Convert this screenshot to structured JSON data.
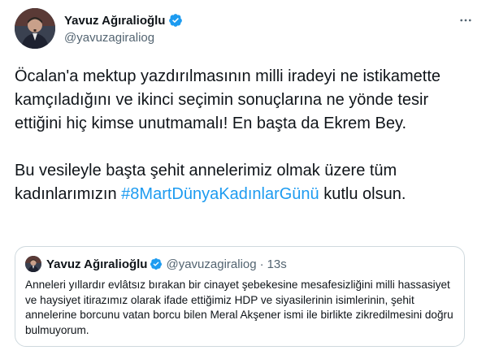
{
  "tweet": {
    "author_name": "Yavuz Ağıralioğlu",
    "author_handle": "@yavuzagiraliog",
    "paragraph1": "Öcalan'a mektup yazdırılmasının milli iradeyi ne istikamette kamçıladığını ve ikinci seçimin sonuçlarına ne yönde tesir ettiğini hiç kimse unutmamalı! En başta da Ekrem Bey.",
    "paragraph2_before": "Bu vesileyle başta şehit annelerimiz olmak üzere tüm kadınlarımızın ",
    "paragraph2_hashtag": "#8MartDünyaKadınlarGünü",
    "paragraph2_after": " kutlu olsun."
  },
  "quote": {
    "author_name": "Yavuz Ağıralioğlu",
    "author_handle": "@yavuzagiraliog",
    "separator": "·",
    "time": "13s",
    "text": "Anneleri yıllardır evlâtsız bırakan bir cinayet şebekesine mesafesizliğini milli hassasiyet ve haysiyet itirazımız olarak ifade ettiğimiz HDP ve siyasilerinin isimlerinin, şehit annelerine borcunu vatan borcu bilen Meral Akşener ismi ile birlikte zikredilmesini doğru bulmuyorum."
  },
  "icons": {
    "verified": "verified-badge-icon",
    "more": "more-options-icon"
  },
  "colors": {
    "accent": "#1d9bf0",
    "text": "#0f1419",
    "secondary": "#536471",
    "border": "#cfd9de"
  }
}
